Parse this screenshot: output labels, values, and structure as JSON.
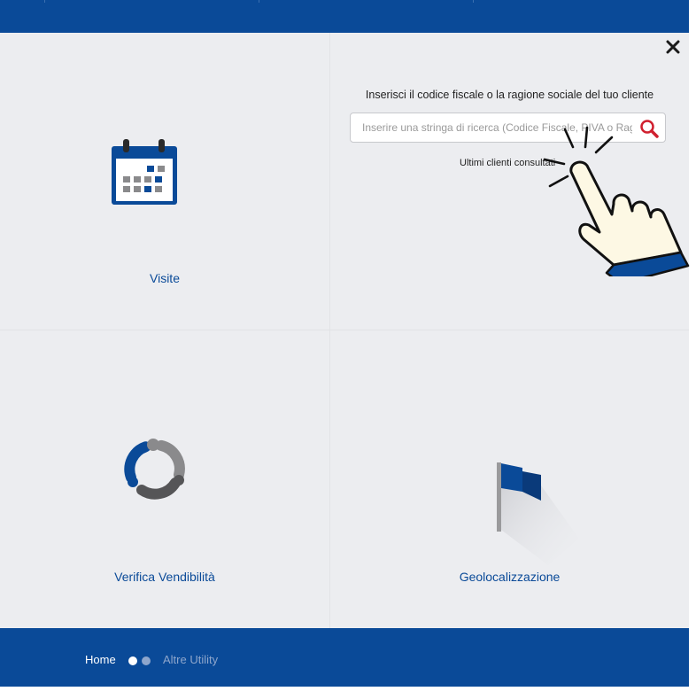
{
  "header": {},
  "tiles": {
    "visite": {
      "label": "Visite",
      "icon": "calendar-icon"
    },
    "verifica": {
      "label": "Verifica Vendibilità",
      "icon": "sync-circle-icon"
    },
    "geolocalizzazione": {
      "label": "Geolocalizzazione",
      "icon": "flag-icon"
    }
  },
  "search_panel": {
    "title": "Inserisci il codice fiscale o la ragione sociale del tuo cliente",
    "placeholder": "Inserire una stringa di ricerca (Codice Fiscale, PIVA o Ragione Sociale)",
    "recent_label": "Ultimi clienti consultati",
    "close_icon": "close-icon",
    "search_icon": "search-icon",
    "overlay_icon": "tap-hand-icon"
  },
  "footer": {
    "home_label": "Home",
    "altre_label": "Altre Utility",
    "pager_active": 1,
    "pager_total": 2
  },
  "colors": {
    "brand_blue": "#0a4a98",
    "tile_bg": "#ecedf0",
    "icon_gray": "#8a8a8c",
    "search_red": "#d0202f"
  }
}
